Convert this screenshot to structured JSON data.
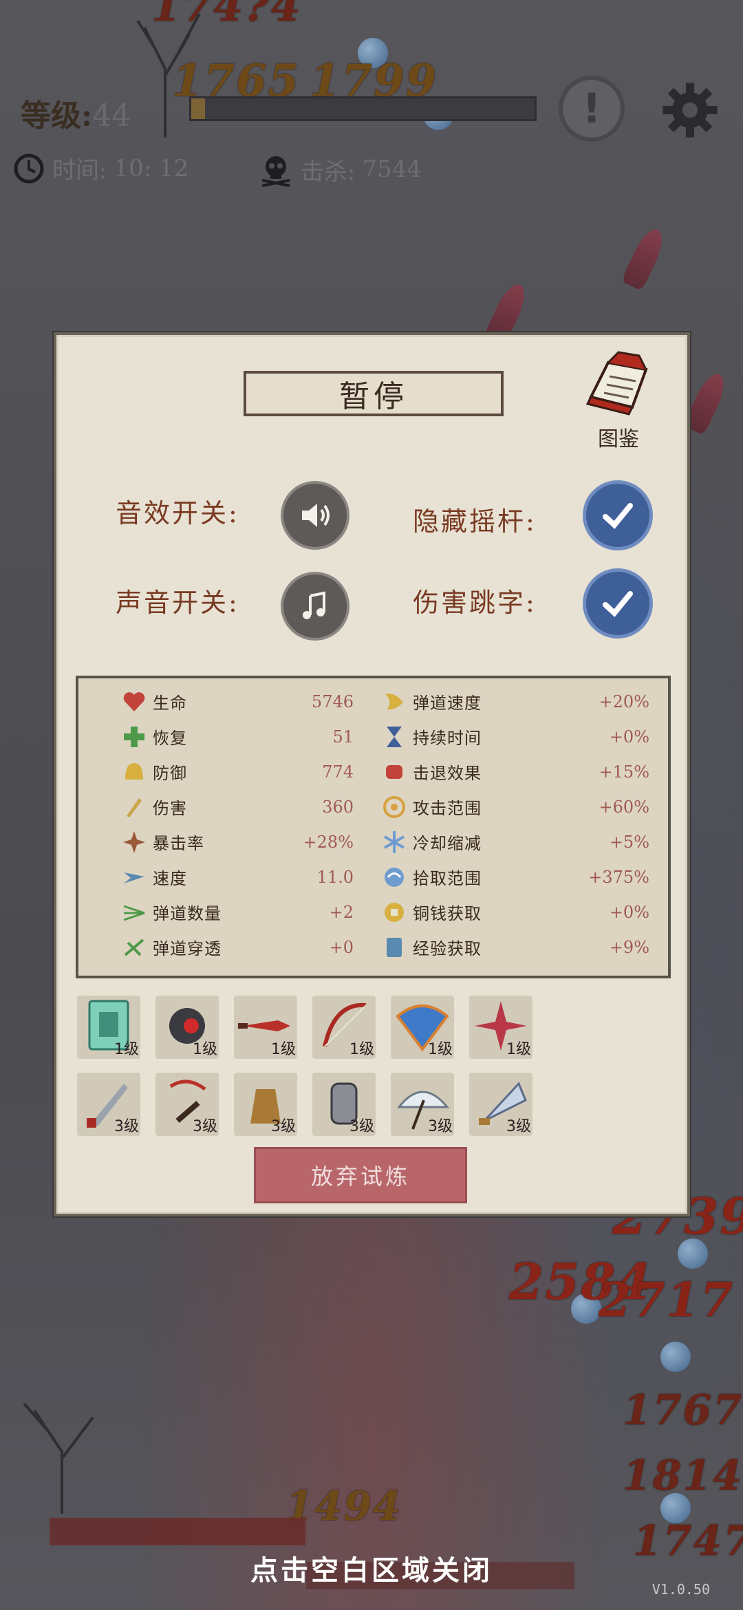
{
  "hud": {
    "level_label": "等级:",
    "level_value": "44",
    "xp_fraction": 0.04,
    "time_label": "时间:",
    "time_value": "10: 12",
    "kills_label": "击杀:",
    "kills_value": "7544"
  },
  "floating_damage": [
    "174?4",
    "1765",
    "1799",
    "2584",
    "2717",
    "2739",
    "1767",
    "1814",
    "1747",
    "1494"
  ],
  "panel": {
    "title": "暂停",
    "codex_label": "图鉴",
    "toggles": [
      {
        "label": "音效开关:",
        "icon": "speaker-icon",
        "state": "on"
      },
      {
        "label": "隐藏摇杆:",
        "icon": "checkmark-icon",
        "state": "checked"
      },
      {
        "label": "声音开关:",
        "icon": "music-note-icon",
        "state": "on"
      },
      {
        "label": "伤害跳字:",
        "icon": "checkmark-icon",
        "state": "checked"
      }
    ],
    "stats_left": [
      {
        "name": "生命",
        "value": "5746",
        "icon": "heart-icon"
      },
      {
        "name": "恢复",
        "value": "51",
        "icon": "heal-cross-icon"
      },
      {
        "name": "防御",
        "value": "774",
        "icon": "helmet-icon"
      },
      {
        "name": "伤害",
        "value": "360",
        "icon": "sword-icon"
      },
      {
        "name": "暴击率",
        "value": "+28%",
        "icon": "crit-star-icon"
      },
      {
        "name": "速度",
        "value": "11.0",
        "icon": "speed-wing-icon"
      },
      {
        "name": "弹道数量",
        "value": "+2",
        "icon": "multi-arrow-icon"
      },
      {
        "name": "弹道穿透",
        "value": "+0",
        "icon": "pierce-icon"
      }
    ],
    "stats_right": [
      {
        "name": "弹道速度",
        "value": "+20%",
        "icon": "projectile-speed-icon"
      },
      {
        "name": "持续时间",
        "value": "+0%",
        "icon": "hourglass-icon"
      },
      {
        "name": "击退效果",
        "value": "+15%",
        "icon": "fist-icon"
      },
      {
        "name": "攻击范围",
        "value": "+60%",
        "icon": "target-icon"
      },
      {
        "name": "冷却缩减",
        "value": "+5%",
        "icon": "snowflake-icon"
      },
      {
        "name": "拾取范围",
        "value": "+375%",
        "icon": "pickup-icon"
      },
      {
        "name": "铜钱获取",
        "value": "+0%",
        "icon": "coin-icon"
      },
      {
        "name": "经验获取",
        "value": "+9%",
        "icon": "scroll-book-icon"
      }
    ],
    "weapons": [
      {
        "icon": "jade-scroll-icon",
        "level": "1级"
      },
      {
        "icon": "red-gem-ring-icon",
        "level": "1级"
      },
      {
        "icon": "red-dagger-icon",
        "level": "1级"
      },
      {
        "icon": "red-bow-icon",
        "level": "1级"
      },
      {
        "icon": "folding-fan-icon",
        "level": "1级"
      },
      {
        "icon": "shuriken-icon",
        "level": "1级"
      }
    ],
    "passives": [
      {
        "icon": "short-blade-icon",
        "level": "3级"
      },
      {
        "icon": "brush-pendant-icon",
        "level": "3级"
      },
      {
        "icon": "gourd-bag-icon",
        "level": "3级"
      },
      {
        "icon": "bracer-icon",
        "level": "3级"
      },
      {
        "icon": "paper-umbrella-icon",
        "level": "3级"
      },
      {
        "icon": "feather-fan-icon",
        "level": "3级"
      }
    ],
    "quit_button": "放弃试炼"
  },
  "close_hint": "点击空白区域关闭",
  "version": "V1.0.50",
  "colors": {
    "panel_bg": "#e7e2d4",
    "stat_value": "#a05a52",
    "toggle_blue": "#3f5f98",
    "quit_button": "#b9666a"
  }
}
